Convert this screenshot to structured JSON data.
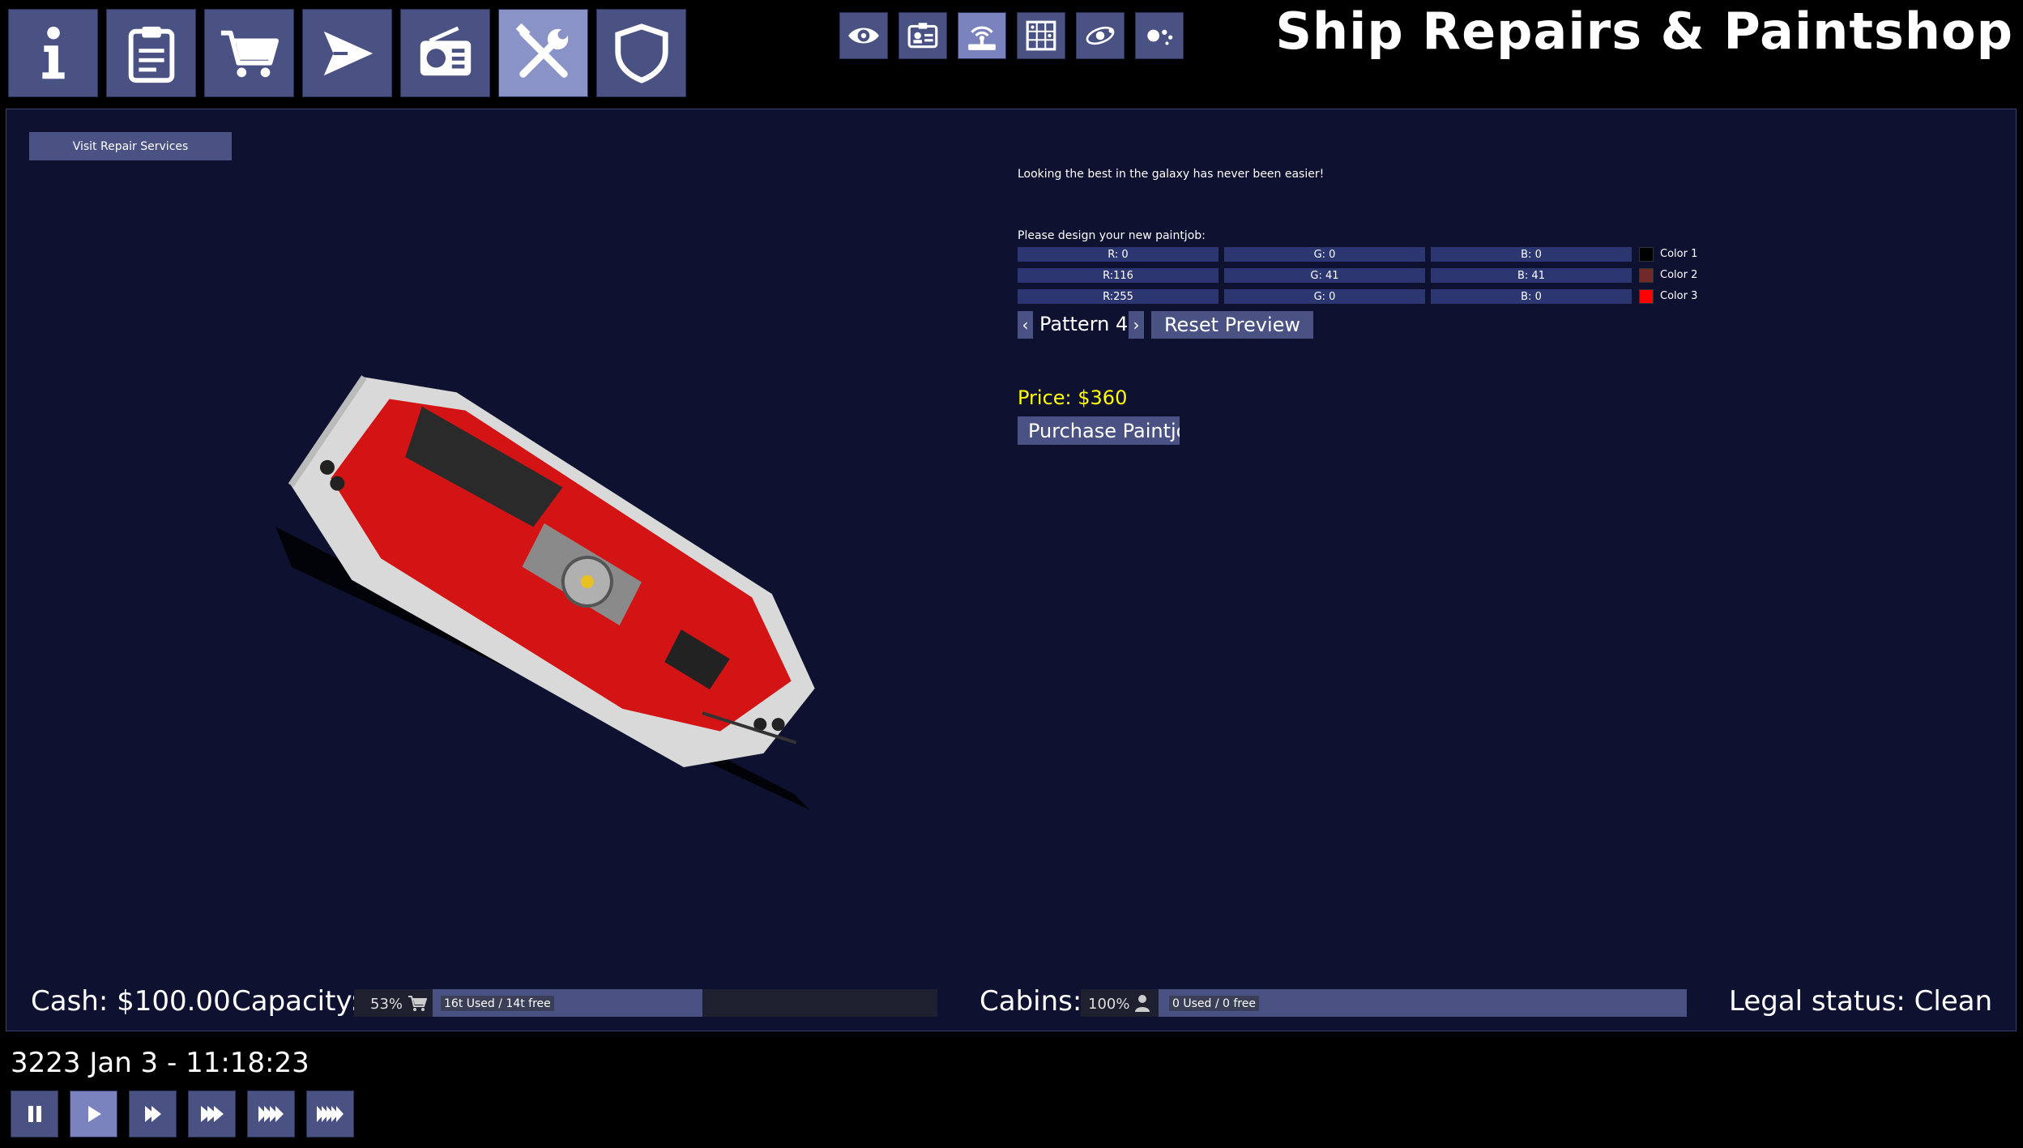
{
  "header": {
    "title": "Ship Repairs & Paintshop",
    "nav_buttons": [
      {
        "icon": "info-icon",
        "active": false
      },
      {
        "icon": "clipboard-icon",
        "active": false
      },
      {
        "icon": "cart-icon",
        "active": false
      },
      {
        "icon": "ship-icon",
        "active": false
      },
      {
        "icon": "radio-icon",
        "active": false
      },
      {
        "icon": "tools-icon",
        "active": true
      },
      {
        "icon": "shield-icon",
        "active": false
      }
    ],
    "view_buttons": [
      {
        "icon": "eye-icon",
        "active": false
      },
      {
        "icon": "id-card-icon",
        "active": false
      },
      {
        "icon": "antenna-icon",
        "active": true
      },
      {
        "icon": "grid-icon",
        "active": false
      },
      {
        "icon": "orbit-icon",
        "active": false
      },
      {
        "icon": "system-icon",
        "active": false
      }
    ]
  },
  "repairs": {
    "visit_button": "Visit Repair Services"
  },
  "paintshop": {
    "tagline": "Looking the best in the galaxy has never been easier!",
    "prompt": "Please design your new paintjob:",
    "colors": [
      {
        "r": "R: 0",
        "g": "G: 0",
        "b": "B: 0",
        "label": "Color 1",
        "swatch": "#000000"
      },
      {
        "r": "R:116",
        "g": "G: 41",
        "b": "B: 41",
        "label": "Color 2",
        "swatch": "#742929"
      },
      {
        "r": "R:255",
        "g": "G: 0",
        "b": "B: 0",
        "label": "Color 3",
        "swatch": "#ff0000"
      }
    ],
    "pattern_prev": "‹",
    "pattern_label": "Pattern 4",
    "pattern_next": "›",
    "reset_button": "Reset Preview",
    "price": "Price: $360",
    "purchase_button": "Purchase Paintjob"
  },
  "status": {
    "cash": "Cash: $100.00",
    "capacity_label": "Capacity:",
    "capacity_pct": "53%",
    "capacity_fill": 0.46,
    "capacity_chip": "16t Used / 14t free",
    "cabins_label": "Cabins:",
    "cabins_pct": "100%",
    "cabins_fill": 1.0,
    "cabins_chip": "0 Used / 0 free",
    "legal": "Legal status: Clean"
  },
  "time": {
    "datetime": "3223 Jan 3 - 11:18:23",
    "speed_buttons": [
      {
        "icon": "pause-icon",
        "active": false
      },
      {
        "icon": "play-icon",
        "active": true
      },
      {
        "icon": "fast-forward-2-icon",
        "active": false
      },
      {
        "icon": "fast-forward-3-icon",
        "active": false
      },
      {
        "icon": "fast-forward-4-icon",
        "active": false
      },
      {
        "icon": "fast-forward-5-icon",
        "active": false
      }
    ]
  },
  "colors": {
    "accent": "#4a5183",
    "active": "#8a93c8",
    "panel": "#0e1130",
    "price": "#ffff00"
  }
}
